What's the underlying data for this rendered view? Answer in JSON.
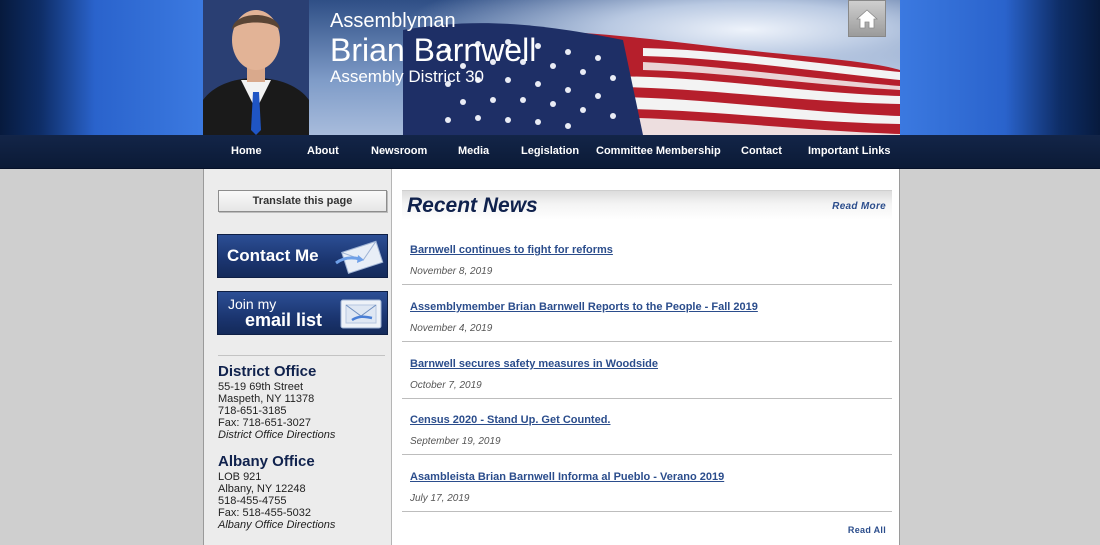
{
  "header": {
    "title_small": "Assemblyman",
    "title_name": "Brian Barnwell",
    "title_district": "Assembly District 30",
    "home_icon": "home-icon"
  },
  "nav": {
    "items": [
      "Home",
      "About",
      "Newsroom",
      "Media",
      "Legislation",
      "Committee Membership",
      "Contact",
      "Important Links"
    ]
  },
  "sidebar": {
    "translate_label": "Translate this page",
    "contact_label": "Contact Me",
    "email_line1": "Join my",
    "email_line2": "email list",
    "district": {
      "heading": "District Office",
      "address1": "55-19 69th Street",
      "address2": "Maspeth, NY 11378",
      "phone": "718-651-3185",
      "fax": "Fax: 718-651-3027",
      "directions": "District Office Directions"
    },
    "albany": {
      "heading": "Albany Office",
      "address1": "LOB 921",
      "address2": "Albany, NY 12248",
      "phone": "518-455-4755",
      "fax": "Fax: 518-455-5032",
      "directions": "Albany Office Directions"
    }
  },
  "news": {
    "title": "Recent News",
    "read_more": "Read More",
    "read_all": "Read All",
    "items": [
      {
        "title": "Barnwell continues to fight for reforms",
        "date": "November 8, 2019"
      },
      {
        "title": "Assemblymember Brian Barnwell Reports to the People - Fall 2019",
        "date": "November 4, 2019"
      },
      {
        "title": "Barnwell secures safety measures in Woodside",
        "date": "October 7, 2019"
      },
      {
        "title": "Census 2020 - Stand Up. Get Counted.",
        "date": "September 19, 2019"
      },
      {
        "title": "Asambleista Brian Barnwell Informa al Pueblo - Verano 2019",
        "date": "July 17, 2019"
      }
    ]
  },
  "colors": {
    "navy": "#10224d",
    "link": "#2b4d8c",
    "nav_bg": "#0b1a36",
    "header_blue": "#3b79e0"
  }
}
